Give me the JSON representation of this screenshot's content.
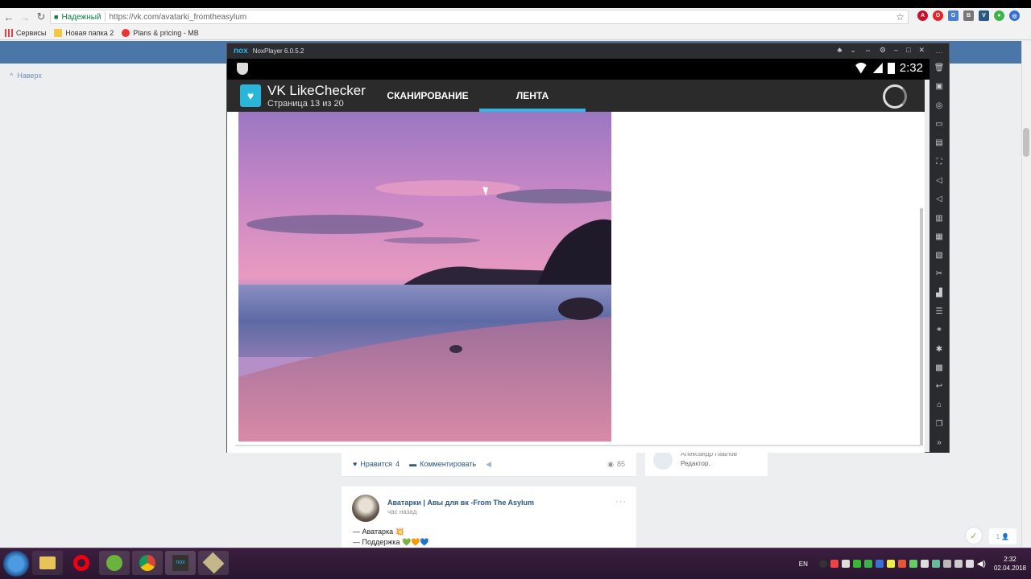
{
  "browser": {
    "secure_label": "Надежный",
    "url": "https://vk.com/avatarki_fromtheasylum",
    "bookmarks": [
      {
        "label": "Сервисы",
        "icon": "apps-grid-icon"
      },
      {
        "label": "Новая папка 2",
        "icon": "folder-icon"
      },
      {
        "label": "Plans & pricing - MB",
        "icon": "mb-logo-icon"
      }
    ]
  },
  "vk": {
    "back_to_top": "Наверх",
    "post_actions": {
      "likes_label": "Нравится",
      "likes_count": "4",
      "comment_label": "Комментировать",
      "views": "85"
    },
    "side_card": {
      "name": "Александр Павлов",
      "role": "Редактор."
    },
    "post2": {
      "author": "Аватарки | Авы для вк -From The Asylum",
      "time": "час назад",
      "line1": "— Аватарка 💥",
      "line2": "— Поддержка 💚🧡💙"
    },
    "online_users": "1"
  },
  "nox": {
    "window_title": "NoxPlayer 6.0.5.2",
    "logo": "nox",
    "status_time": "2:32",
    "app": {
      "title": "VK LikeChecker",
      "subtitle": "Страница 13 из 20",
      "tabs": [
        {
          "label": "СКАНИРОВАНИЕ",
          "active": false
        },
        {
          "label": "ЛЕНТА",
          "active": true
        }
      ]
    },
    "accent_color": "#33b5e5"
  },
  "taskbar": {
    "lang": "EN",
    "time": "2:32",
    "date": "02.04.2018"
  }
}
